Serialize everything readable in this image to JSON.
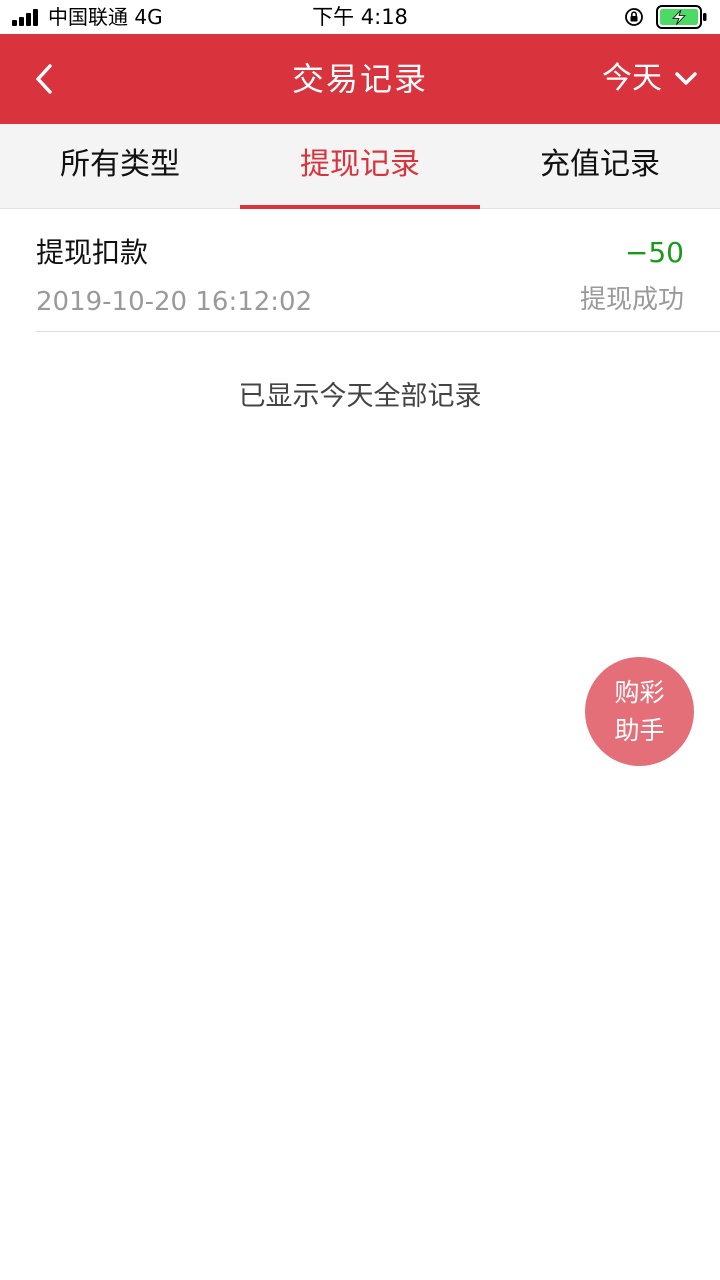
{
  "status_bar": {
    "carrier": "中国联通 4G",
    "time": "下午 4:18",
    "icons": [
      "signal-icon",
      "rotation-lock-icon",
      "battery-charging-icon"
    ],
    "battery_color": "#4cd964"
  },
  "nav": {
    "back_icon": "chevron-left-icon",
    "title": "交易记录",
    "date_filter_label": "今天",
    "date_filter_icon": "chevron-down-icon"
  },
  "tabs": [
    {
      "label": "所有类型",
      "active": false
    },
    {
      "label": "提现记录",
      "active": true
    },
    {
      "label": "充值记录",
      "active": false
    }
  ],
  "records": [
    {
      "title": "提现扣款",
      "amount": "−50",
      "time": "2019-10-20 16:12:02",
      "status": "提现成功"
    }
  ],
  "end_note": "已显示今天全部记录",
  "floating_button": {
    "line1": "购彩",
    "line2": "助手"
  },
  "colors": {
    "brand_red": "#d9343e",
    "amount_green": "#1a9a1a",
    "float_button": "#e56f79"
  }
}
